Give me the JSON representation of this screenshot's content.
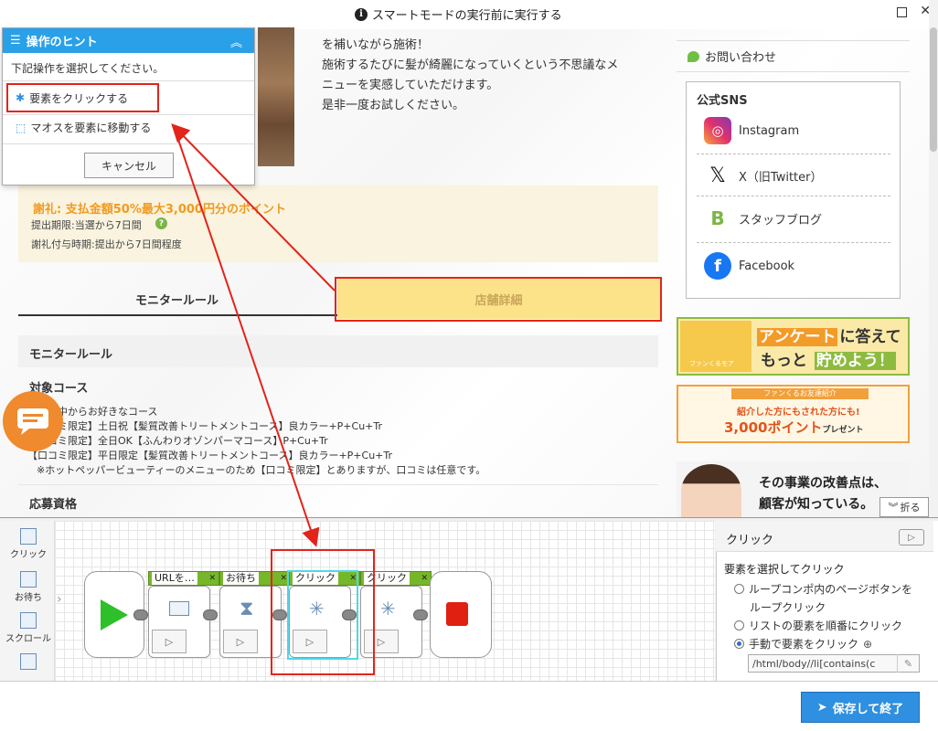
{
  "topbar": {
    "title": "スマートモードの実行前に実行する"
  },
  "page": {
    "description_lines": [
      "を補いながら施術！",
      "施術するたびに髪が綺麗になっていくという不思議なメ",
      "ニューを実感していただけます。",
      "是非一度お試しください。"
    ],
    "reward": {
      "title": "謝礼: 支払金額50%最大3,000円分のポイント",
      "line1": "提出期限:当選から7日間",
      "line2": "謝礼付与時期:提出から7日間程度"
    },
    "tabs": {
      "monitor": "モニタールール",
      "shop": "店舗詳細"
    },
    "section_title": "モニタールール",
    "target_heading": "対象コース",
    "courses": [
      "以下の中からお好きなコース",
      "【口コミ限定】土日祝【髪質改善トリートメントコース】良カラー+P+Cu+Tr",
      "【口コミ限定】全日OK【ふんわりオゾンパーマコース】P+Cu+Tr",
      "【口コミ限定】平日限定【髪質改善トリートメントコース】良カラー+P+Cu+Tr",
      "※ホットペッパービューティーのメニューのため【口コミ限定】とありますが、口コミは任意です。"
    ],
    "apply_heading": "応募資格"
  },
  "sidebar": {
    "contact": "お問い合わせ",
    "sns_title": "公式SNS",
    "sns": [
      {
        "label": "Instagram",
        "icon": "instagram-icon"
      },
      {
        "label": "X（旧Twitter）",
        "icon": "x-icon"
      },
      {
        "label": "スタッフブログ",
        "icon": "blog-icon"
      },
      {
        "label": "Facebook",
        "icon": "facebook-icon"
      }
    ],
    "banner1": {
      "word1": "アンケート",
      "word2": "に答えて",
      "line2a": "もっと",
      "word3": "貯めよう！",
      "small": "ファンくるモア"
    },
    "banner2": {
      "top": "ファンくるお友達紹介",
      "mid": "紹介した方にもされた方にも!",
      "big": "3,000ポイント",
      "small": "プレゼント"
    },
    "banner3": {
      "line1": "その事業の改善点は、",
      "line2": "顧客が知っている。"
    },
    "fold_label": "折る"
  },
  "hint": {
    "title": "操作のヒント",
    "subtitle": "下記操作を選択してください。",
    "option1": "要素をクリックする",
    "option2": "マオスを要素に移動する",
    "cancel": "キャンセル"
  },
  "workflow": {
    "tools": [
      {
        "label": "クリック"
      },
      {
        "label": "お待ち"
      },
      {
        "label": "スクロール"
      }
    ],
    "blocks": [
      {
        "label": "URLを…"
      },
      {
        "label": "お待ち"
      },
      {
        "label": "クリック"
      },
      {
        "label": "クリック"
      }
    ]
  },
  "props": {
    "title": "クリック",
    "subtitle": "要素を選択してクリック",
    "opt1a": "ループコンポ内のページボタンを",
    "opt1b": "ループクリック",
    "opt2": "リストの要素を順番にクリック",
    "opt3": "手動で要素をクリック",
    "xpath": "/html/body//li[contains(c"
  },
  "footer": {
    "save_label": "保存して終了"
  },
  "colors": {
    "accent": "#29a0e8",
    "highlight": "#e3241b",
    "tab_active": "#fce38a",
    "block_green": "#76b72a"
  }
}
